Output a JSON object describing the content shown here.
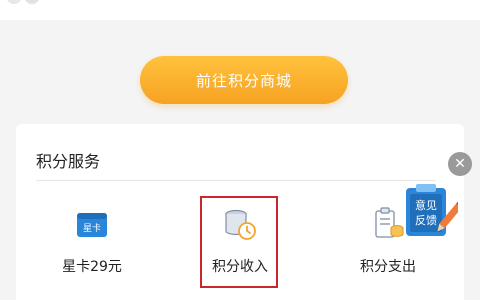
{
  "cta": {
    "label": "前往积分商城"
  },
  "points_service": {
    "title": "积分服务",
    "items": [
      {
        "label": "星卡29元",
        "icon": "star-card-icon",
        "icon_text": "星卡"
      },
      {
        "label": "积分收入",
        "icon": "coins-clock-icon",
        "highlighted": true
      },
      {
        "label": "积分支出",
        "icon": "coins-list-icon"
      }
    ]
  },
  "feedback_widget": {
    "line1": "意见",
    "line2": "反馈",
    "icon": "feedback-pencil-icon"
  },
  "close_button": {
    "icon": "close-icon",
    "glyph": "✕"
  },
  "colors": {
    "accent_orange": "#f6a222",
    "icon_blue": "#2a86d8",
    "highlight_red": "#c8282d"
  }
}
